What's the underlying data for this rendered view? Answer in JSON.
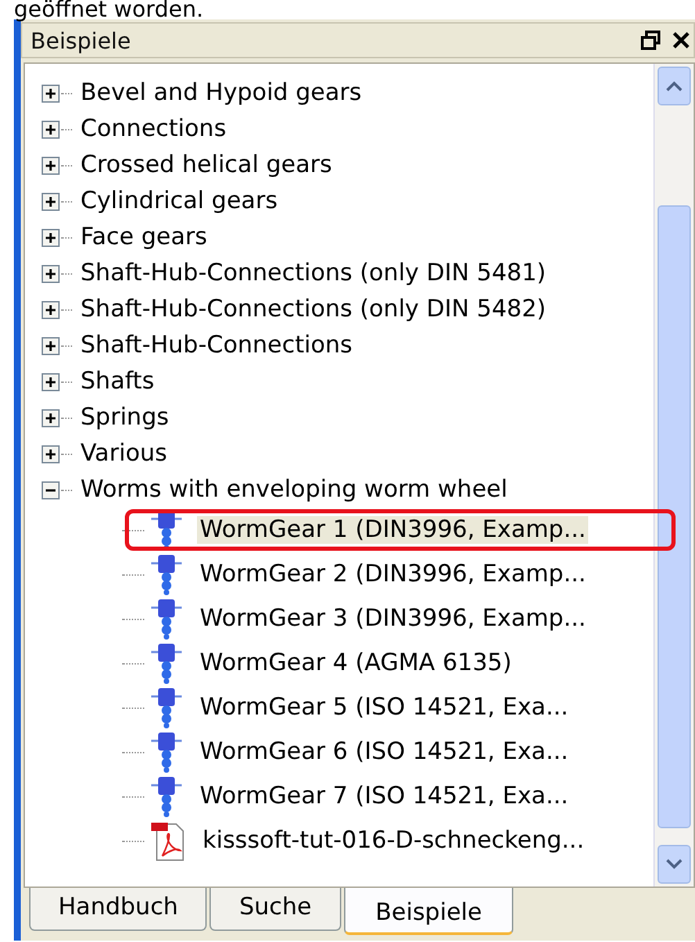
{
  "caption": "geöffnet worden.",
  "panel": {
    "title": "Beispiele"
  },
  "tree": [
    {
      "label": "Bevel and Hypoid gears",
      "expanded": false,
      "selected": false
    },
    {
      "label": "Connections",
      "expanded": false,
      "selected": false
    },
    {
      "label": "Crossed helical gears",
      "expanded": false,
      "selected": false
    },
    {
      "label": "Cylindrical gears",
      "expanded": false,
      "selected": false
    },
    {
      "label": "Face gears",
      "expanded": false,
      "selected": false
    },
    {
      "label": "Shaft-Hub-Connections (only DIN 5481)",
      "expanded": false,
      "selected": false
    },
    {
      "label": "Shaft-Hub-Connections (only DIN 5482)",
      "expanded": false,
      "selected": false
    },
    {
      "label": "Shaft-Hub-Connections",
      "expanded": false,
      "selected": false
    },
    {
      "label": "Shafts",
      "expanded": false,
      "selected": false
    },
    {
      "label": "Springs",
      "expanded": false,
      "selected": false
    },
    {
      "label": "Various",
      "expanded": false,
      "selected": false
    },
    {
      "label": "Worms with enveloping worm wheel",
      "expanded": true,
      "selected": false,
      "children": [
        {
          "label": "WormGear 1 (DIN3996, Examp...",
          "kind": "gear",
          "selected": true
        },
        {
          "label": "WormGear 2 (DIN3996, Examp...",
          "kind": "gear",
          "selected": false
        },
        {
          "label": "WormGear 3 (DIN3996, Examp...",
          "kind": "gear",
          "selected": false
        },
        {
          "label": "WormGear 4 (AGMA 6135)",
          "kind": "gear",
          "selected": false
        },
        {
          "label": "WormGear 5 (ISO 14521, Exa...",
          "kind": "gear",
          "selected": false
        },
        {
          "label": "WormGear 6 (ISO 14521, Exa...",
          "kind": "gear",
          "selected": false
        },
        {
          "label": "WormGear 7 (ISO 14521, Exa...",
          "kind": "gear",
          "selected": false
        },
        {
          "label": "kisssoft-tut-016-D-schneckeng...",
          "kind": "pdf",
          "selected": false
        }
      ]
    }
  ],
  "tabs": [
    {
      "label": "Handbuch",
      "selected": false
    },
    {
      "label": "Suche",
      "selected": false
    },
    {
      "label": "Beispiele",
      "selected": true
    }
  ]
}
